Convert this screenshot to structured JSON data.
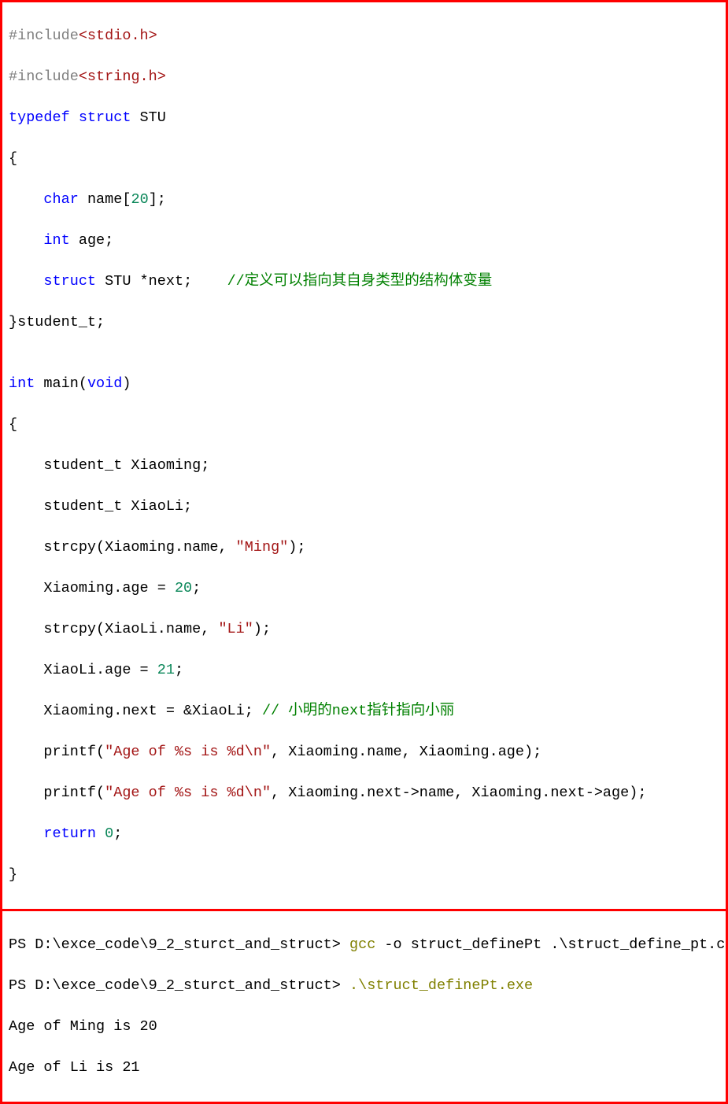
{
  "code": {
    "line1_pre": "#include",
    "line1_hdr": "<stdio.h>",
    "line2_pre": "#include",
    "line2_hdr": "<string.h>",
    "line3_kw1": "typedef",
    "line3_kw2": "struct",
    "line3_name": " STU",
    "line4": "{",
    "line5_indent": "    ",
    "line5_ty": "char",
    "line5_rest": " name[",
    "line5_num": "20",
    "line5_end": "];",
    "line6_indent": "    ",
    "line6_ty": "int",
    "line6_rest": " age;",
    "line7_indent": "    ",
    "line7_kw": "struct",
    "line7_rest": " STU *next;    ",
    "line7_cmt": "//定义可以指向其自身类型的结构体变量",
    "line8": "}student_t;",
    "blank1": "",
    "line9_ty": "int",
    "line9_rest": " main(",
    "line9_void": "void",
    "line9_end": ")",
    "line10": "{",
    "line11": "    student_t Xiaoming;",
    "line12": "    student_t XiaoLi;",
    "line13_a": "    strcpy(Xiaoming.name, ",
    "line13_str": "\"Ming\"",
    "line13_b": ");",
    "line14_a": "    Xiaoming.age = ",
    "line14_num": "20",
    "line14_b": ";",
    "line15_a": "    strcpy(XiaoLi.name, ",
    "line15_str": "\"Li\"",
    "line15_b": ");",
    "line16_a": "    XiaoLi.age = ",
    "line16_num": "21",
    "line16_b": ";",
    "line17_a": "    Xiaoming.next = &XiaoLi; ",
    "line17_cmt_a": "// 小明的",
    "line17_cmt_b": "next",
    "line17_cmt_c": "指针指向小丽",
    "line18_a": "    printf(",
    "line18_str": "\"Age of %s is %d\\n\"",
    "line18_b": ", Xiaoming.name, Xiaoming.age);",
    "line19_a": "    printf(",
    "line19_str": "\"Age of %s is %d\\n\"",
    "line19_b": ", Xiaoming.next->name, Xiaoming.next->age);",
    "line20_a": "    ",
    "line20_kw": "return",
    "line20_b": " ",
    "line20_num": "0",
    "line20_c": ";",
    "line21": "}"
  },
  "term": {
    "line1_a": "PS D:\\exce_code\\9_2_sturct_and_struct> ",
    "line1_cmd": "gcc",
    "line1_b": " -o struct_definePt .\\struct_define_pt.c",
    "line2_a": "PS D:\\exce_code\\9_2_sturct_and_struct> ",
    "line2_cmd": ".\\struct_definePt.exe",
    "line3": "Age of Ming is 20",
    "line4": "Age of Li is 21"
  }
}
